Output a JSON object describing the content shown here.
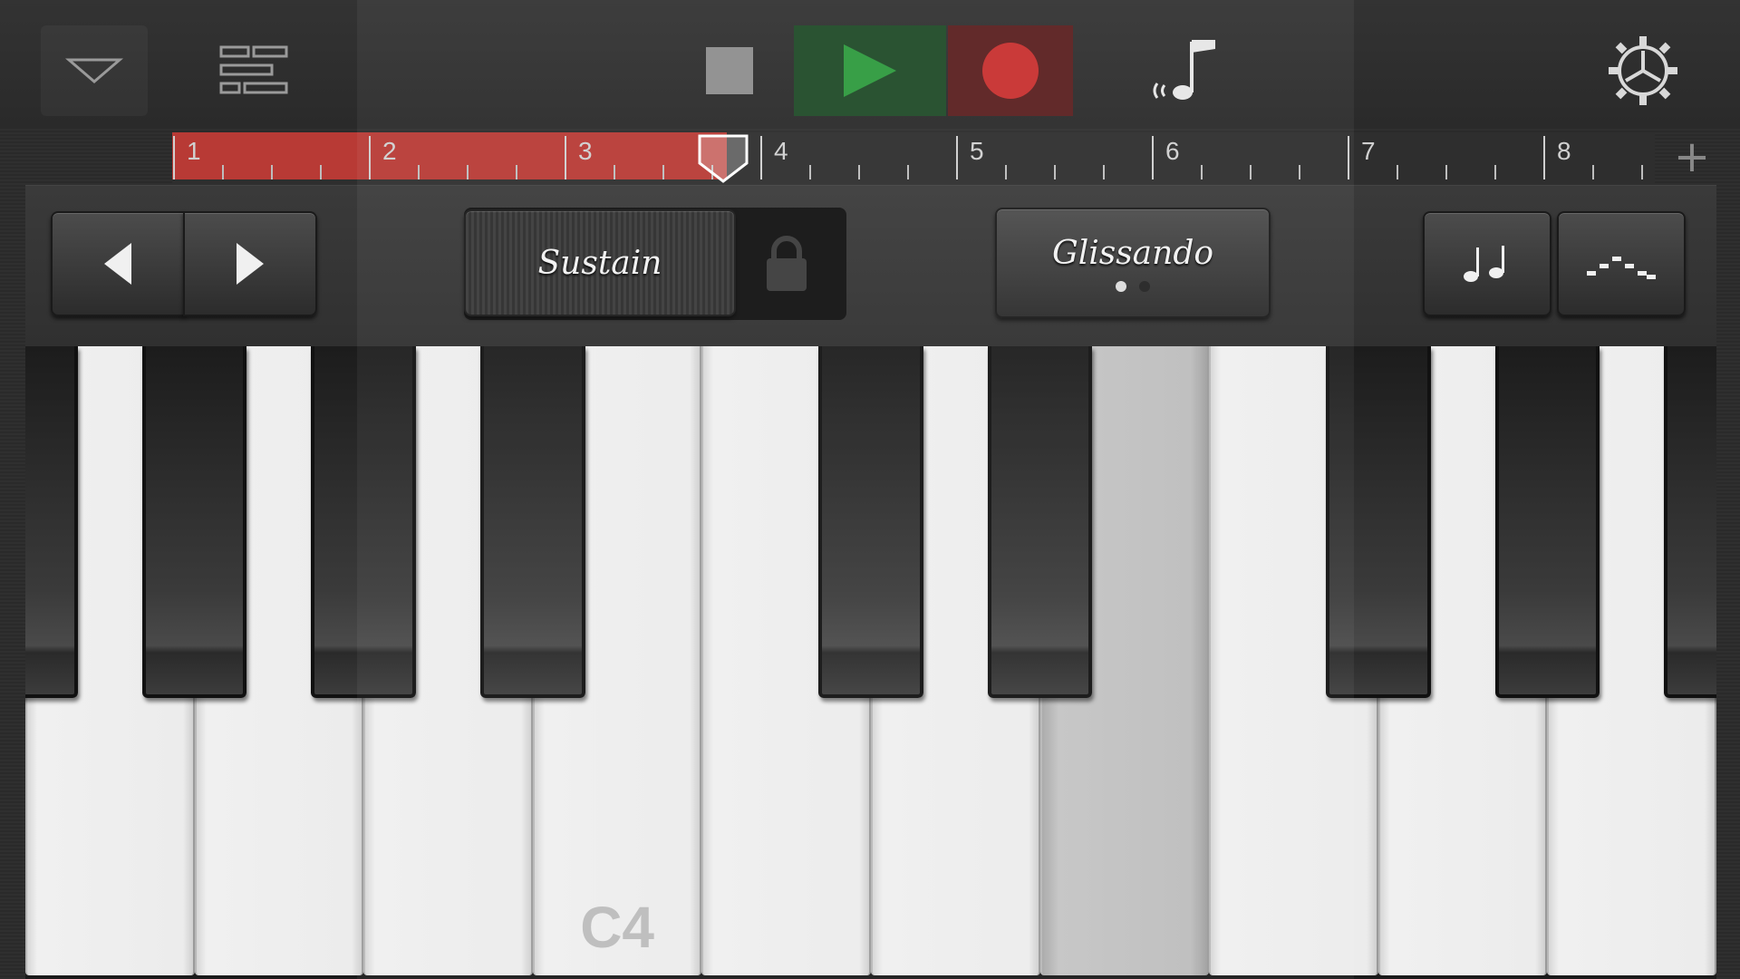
{
  "toolbar": {
    "browser_icon": "triangle-down-icon",
    "tracks_icon": "tracks-view-icon",
    "stop_icon": "stop-icon",
    "play_icon": "play-icon",
    "record_icon": "record-icon",
    "smart_controls_icon": "note-icon",
    "settings_icon": "gear-icon",
    "colors": {
      "play_bg": "#1f4a27",
      "play": "#2e9a3e",
      "record_bg": "#5a1f1f",
      "record": "#c8302f"
    }
  },
  "ruler": {
    "bars": [
      "1",
      "2",
      "3",
      "4",
      "5",
      "6",
      "7",
      "8"
    ],
    "region_color": "#b83a35",
    "add_label": "+"
  },
  "controls": {
    "sustain_label": "Sustain",
    "glissando_label": "Glissando",
    "glissando_page": 1,
    "glissando_pages": 2,
    "octave_down_icon": "left-arrow-icon",
    "octave_up_icon": "right-arrow-icon",
    "lock_icon": "lock-icon",
    "arpeggiator_icon": "notes-icon",
    "scale_icon": "scale-icon"
  },
  "keyboard": {
    "white_keys": 10,
    "c_label": "C4",
    "c_label_key": 3,
    "pressed_key": 6,
    "black_keys_after_white": [
      0,
      1,
      2,
      4,
      5,
      7,
      8,
      9
    ]
  }
}
